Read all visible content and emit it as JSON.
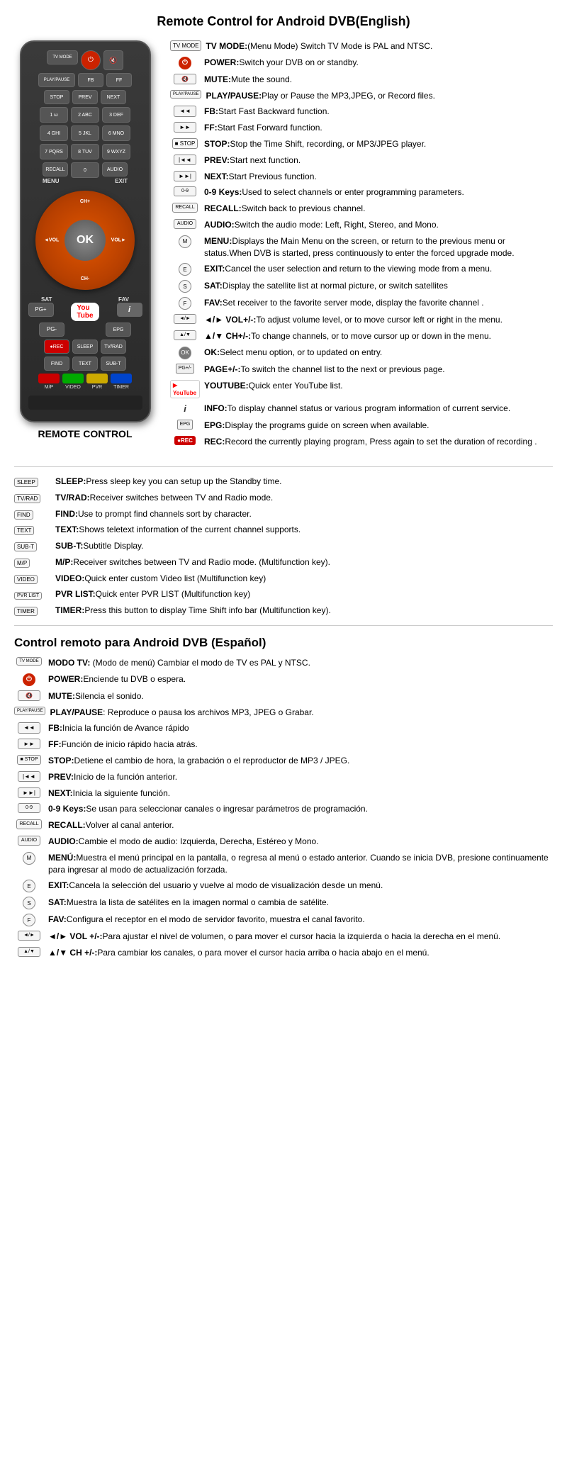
{
  "page": {
    "title_en": "Remote Control for Android DVB(English)",
    "title_es": "Control remoto para Android DVB (Español)",
    "remote_label": "REMOTE CONTROL"
  },
  "remote": {
    "buttons": {
      "tv_mode": "TV MODE",
      "power": "⏻",
      "mute": "🔇",
      "play_pause": "PLAY/PAUSE",
      "fb": "FB",
      "ff": "FF",
      "stop": "STOP",
      "prev": "PREV",
      "next": "NEXT",
      "recall": "RECALL",
      "audio": "AUDIO",
      "menu": "MENU",
      "exit": "EXIT",
      "ok": "OK",
      "sat": "Sat",
      "fav": "FAV",
      "pg_plus": "PG+",
      "pg_minus": "PG-",
      "epg": "EPG",
      "rec": "REC",
      "sleep": "SLEEP",
      "tv_rad": "TV/RAD",
      "find": "FIND",
      "text": "TEXT",
      "sub_t": "SUB-T",
      "mp": "M/P",
      "video": "VIDEO",
      "pvr": "PVR",
      "timer": "TIMER"
    },
    "numpad": [
      "1 ω",
      "2 ABC",
      "3 DEF",
      "4 GHI",
      "5 JKL",
      "6 MNO",
      "7 PQRS",
      "8 TUV",
      "9 WXYZ",
      "0"
    ]
  },
  "descriptions_en": [
    {
      "icon": "TV MODE",
      "text_bold": "TV MODE:",
      "text": "(Menu Mode) Switch TV Mode is PAL and NTSC."
    },
    {
      "icon": "POWER",
      "text_bold": "POWER:",
      "text": "Switch your DVB on or standby."
    },
    {
      "icon": "MUTE",
      "text_bold": "MUTE:",
      "text": "Mute the sound."
    },
    {
      "icon": "PLAY/PAUSE",
      "text_bold": "PLAY/PAUSE:",
      "text": "Play or Pause the MP3,JPEG, or Record files."
    },
    {
      "icon": "FB",
      "text_bold": "FB:",
      "text": "Start Fast Backward function."
    },
    {
      "icon": "FF",
      "text_bold": "FF:",
      "text": "Start Fast Forward function."
    },
    {
      "icon": "STOP",
      "text_bold": "STOP:",
      "text": "Stop the Time Shift, recording, or MP3/JPEG player."
    },
    {
      "icon": "PREV",
      "text_bold": "PREV:",
      "text": "Start next function."
    },
    {
      "icon": "NEXT",
      "text_bold": "NEXT:",
      "text": "Start Previous function."
    },
    {
      "icon": "0-9",
      "text_bold": "0-9 Keys:",
      "text": "Used to select channels or enter programming parameters."
    },
    {
      "icon": "RECALL",
      "text_bold": "RECALL:",
      "text": "Switch back to previous channel."
    },
    {
      "icon": "AUDIO",
      "text_bold": "AUDIO:",
      "text": "Switch the audio mode: Left, Right, Stereo, and Mono."
    },
    {
      "icon": "MENU",
      "text_bold": "MENU:",
      "text": "Displays the Main Menu on the screen, or return to the previous menu or status.When DVB is started, press continuously to enter the forced upgrade mode."
    },
    {
      "icon": "EXIT",
      "text_bold": "EXIT:",
      "text": "Cancel the user selection and return to the viewing mode from a menu."
    },
    {
      "icon": "SAT",
      "text_bold": "SAT:",
      "text": "Display the satellite list at normal picture, or switch satellites"
    },
    {
      "icon": "FAV",
      "text_bold": "FAV:",
      "text": "Set receiver to the favorite server mode, display the favorite channel ."
    },
    {
      "icon": "VOL",
      "text_bold": "◄/► VOL+/-:",
      "text": "To adjust volume level, or to move cursor left or right in the menu."
    },
    {
      "icon": "CH",
      "text_bold": "▲/▼ CH+/-:",
      "text": "To change channels, or to move cursor up or down in the menu."
    },
    {
      "icon": "OK",
      "text_bold": "OK:",
      "text": "Select menu option, or to updated on entry."
    },
    {
      "icon": "PG",
      "text_bold": "PAGE+/-:",
      "text": "To switch the channel list to the next or previous page."
    },
    {
      "icon": "YOUTUBE",
      "text_bold": "YOUTUBE:",
      "text": "Quick enter YouTube list."
    },
    {
      "icon": "INFO",
      "text_bold": "INFO:",
      "text": "To display channel status or various program information of current service."
    },
    {
      "icon": "EPG",
      "text_bold": "EPG:",
      "text": "Display the programs guide on screen when available."
    },
    {
      "icon": "REC",
      "text_bold": "REC:",
      "text": "Record the currently playing program, Press again to set the duration of recording ."
    }
  ],
  "bottom_buttons_en": [
    {
      "icon": "SLEEP",
      "text_bold": "SLEEP:",
      "text": "Press sleep key you can setup up the Standby time."
    },
    {
      "icon": "TV/RAD",
      "text_bold": "TV/RAD:",
      "text": "Receiver switches between TV and Radio mode."
    },
    {
      "icon": "FIND",
      "text_bold": "FIND:",
      "text": "Use to prompt find channels sort by character."
    },
    {
      "icon": "TEXT",
      "text_bold": "TEXT:",
      "text": "Shows teletext information of the current channel supports."
    },
    {
      "icon": "SUB-T",
      "text_bold": "SUB-T:",
      "text": "Subtitle Display."
    },
    {
      "icon": "M/P",
      "text_bold": "M/P:",
      "text": "Receiver switches between TV and Radio mode. (Multifunction key)."
    },
    {
      "icon": "VIDEO",
      "text_bold": "VIDEO:",
      "text": "Quick enter custom Video list (Multifunction key)"
    },
    {
      "icon": "PVR",
      "text_bold": "PVR LIST:",
      "text": "Quick enter PVR LIST (Multifunction key)"
    },
    {
      "icon": "TIMER",
      "text_bold": "TIMER:",
      "text": "Press this button to display Time Shift info bar (Multifunction key)."
    }
  ],
  "descriptions_es": [
    {
      "icon": "TV MODE",
      "text_bold": "MODO TV:",
      "text": " (Modo de menú) Cambiar el modo de TV es PAL y NTSC."
    },
    {
      "icon": "POWER",
      "text_bold": "POWER:",
      "text": "Enciende tu DVB o espera."
    },
    {
      "icon": "MUTE",
      "text_bold": "MUTE:",
      "text": "Silencia el sonido."
    },
    {
      "icon": "PLAY/PAUSE",
      "text_bold": "PLAY/PAUSE",
      "text": ": Reproduce o pausa los archivos MP3, JPEG o Grabar."
    },
    {
      "icon": "FB",
      "text_bold": "FB:",
      "text": "Inicia la función de Avance rápido"
    },
    {
      "icon": "FF",
      "text_bold": "FF:",
      "text": "Función de inicio rápido hacia atrás."
    },
    {
      "icon": "STOP",
      "text_bold": "STOP:",
      "text": "Detiene el cambio de hora, la grabación o el reproductor de MP3 / JPEG."
    },
    {
      "icon": "PREV",
      "text_bold": "PREV:",
      "text": "Inicio de la función anterior."
    },
    {
      "icon": "NEXT",
      "text_bold": "NEXT:",
      "text": "Inicia la siguiente función."
    },
    {
      "icon": "0-9",
      "text_bold": "0-9 Keys:",
      "text": "Se usan para seleccionar canales o ingresar parámetros de programación."
    },
    {
      "icon": "RECALL",
      "text_bold": "RECALL:",
      "text": "Volver al canal anterior."
    },
    {
      "icon": "AUDIO",
      "text_bold": "AUDIO:",
      "text": "Cambie el modo de audio: Izquierda, Derecha, Estéreo y Mono."
    },
    {
      "icon": "MENU",
      "text_bold": "MENÚ:",
      "text": "Muestra el menú principal en la pantalla, o regresa al menú o estado anterior. Cuando se inicia DVB, presione continuamente para ingresar al modo de actualización forzada."
    },
    {
      "icon": "EXIT",
      "text_bold": "EXIT:",
      "text": "Cancela la selección del usuario y vuelve al modo de visualización desde un menú."
    },
    {
      "icon": "SAT",
      "text_bold": "SAT:",
      "text": "Muestra la lista de satélites en la imagen normal o cambia de satélite."
    },
    {
      "icon": "FAV",
      "text_bold": "FAV:",
      "text": "Configura el receptor en el modo de servidor favorito, muestra el canal favorito."
    },
    {
      "icon": "VOL",
      "text_bold": "◄/► VOL +/-:",
      "text": "Para ajustar el nivel de volumen, o para mover el cursor hacia la izquierda o hacia la derecha en el menú."
    },
    {
      "icon": "CH",
      "text_bold": "▲/▼ CH +/-:",
      "text": "Para cambiar los canales, o para mover el cursor hacia arriba o hacia abajo en el menú."
    }
  ]
}
